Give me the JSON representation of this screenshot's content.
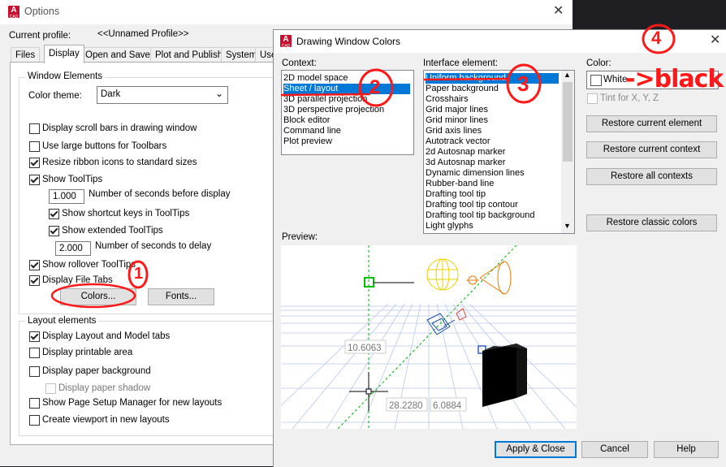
{
  "options": {
    "title": "Options",
    "current_profile_label": "Current profile:",
    "current_profile_value": "<<Unnamed Profile>>",
    "tabs": [
      "Files",
      "Display",
      "Open and Save",
      "Plot and Publish",
      "System",
      "Use"
    ],
    "active_tab": "Display",
    "window_elements": {
      "title": "Window Elements",
      "color_theme_label": "Color theme:",
      "color_theme_value": "Dark",
      "checkboxes": [
        {
          "label": "Display scroll bars in drawing window",
          "checked": false
        },
        {
          "label": "Use large buttons for Toolbars",
          "checked": false
        },
        {
          "label": "Resize ribbon icons to standard sizes",
          "checked": true
        },
        {
          "label": "Show ToolTips",
          "checked": true
        }
      ],
      "seconds_before_display_value": "1.000",
      "seconds_before_display_label": "Number of seconds before display",
      "show_shortcut_keys_label": "Show shortcut keys in ToolTips",
      "show_extended_label": "Show extended ToolTips",
      "seconds_to_delay_value": "2.000",
      "seconds_to_delay_label": "Number of seconds to delay",
      "show_rollover_label": "Show rollover ToolTips",
      "display_file_tabs_label": "Display File Tabs",
      "colors_button": "Colors...",
      "fonts_button": "Fonts..."
    },
    "layout_elements": {
      "title": "Layout elements",
      "items": [
        {
          "label": "Display Layout and Model tabs",
          "checked": true,
          "disabled": false
        },
        {
          "label": "Display printable area",
          "checked": false,
          "disabled": false
        },
        {
          "label": "Display paper background",
          "checked": false,
          "disabled": false
        },
        {
          "label": "Display paper shadow",
          "checked": false,
          "disabled": true
        },
        {
          "label": "Show Page Setup Manager for new layouts",
          "checked": false,
          "disabled": false
        },
        {
          "label": "Create viewport in new layouts",
          "checked": false,
          "disabled": false
        }
      ]
    }
  },
  "dwc": {
    "title": "Drawing Window Colors",
    "context_label": "Context:",
    "context_items": [
      "2D model space",
      "Sheet / layout",
      "3D parallel projection",
      "3D perspective projection",
      "Block editor",
      "Command line",
      "Plot preview"
    ],
    "context_selected": "Sheet / layout",
    "interface_label": "Interface element:",
    "interface_items": [
      "Uniform background",
      "Paper background",
      "Crosshairs",
      "Grid major lines",
      "Grid minor lines",
      "Grid axis lines",
      "Autotrack vector",
      "2d Autosnap marker",
      "3d Autosnap marker",
      "Dynamic dimension lines",
      "Rubber-band line",
      "Drafting tool tip",
      "Drafting tool tip contour",
      "Drafting tool tip background",
      "Light glyphs"
    ],
    "interface_selected": "Uniform background",
    "color_label": "Color:",
    "color_value": "White",
    "tint_label": "Tint for X, Y, Z",
    "buttons": {
      "restore_element": "Restore current element",
      "restore_context": "Restore current context",
      "restore_all": "Restore all contexts",
      "restore_classic": "Restore classic colors",
      "apply_close": "Apply & Close",
      "cancel": "Cancel",
      "help": "Help"
    },
    "preview_label": "Preview:",
    "preview_dims": [
      "10.6063",
      "28.2280",
      "6.0884"
    ]
  },
  "annotations": {
    "n1": "1",
    "n2": "2",
    "n3": "3",
    "n4": "4",
    "black_note": "->black"
  },
  "colors": {
    "selection": "#0078d7",
    "annotation": "#ff1818",
    "preview_grid": "#b8c8ea"
  }
}
